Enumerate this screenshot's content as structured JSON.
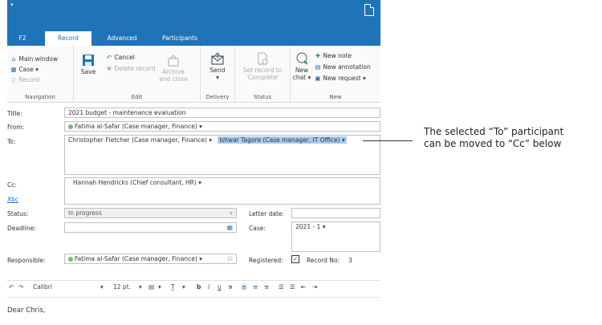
{
  "window": {
    "quick_access": "▾"
  },
  "tabs": [
    "F2",
    "Record",
    "Advanced",
    "Participants"
  ],
  "ribbon": {
    "navigation": {
      "items": [
        "Main window",
        "Case",
        "Record"
      ],
      "label": "Navigation"
    },
    "edit": {
      "save": "Save",
      "cancel": "Cancel",
      "delete": "Delete record",
      "archive": "Archive and close",
      "label": "Edit"
    },
    "delivery": {
      "send": "Send",
      "label": "Delivery"
    },
    "status": {
      "set_complete": "Set record to 'Complete'",
      "label": "Status"
    },
    "new": {
      "new_chat": "New chat",
      "new_note": "New note",
      "new_annotation": "New annotation",
      "new_request": "New request",
      "label": "New"
    }
  },
  "form": {
    "title_label": "Title:",
    "title_value": "2021 budget - maintenance evaluation",
    "from_label": "From:",
    "from_value": "Fatima al-Safar (Case manager, Finance)",
    "to_label": "To:",
    "to_1": "Christopher Fletcher (Case manager, Finance)",
    "to_2": "Ishwar Tagore (Case manager, IT Office)",
    "cc_label": "Cc:",
    "cc_value": "Hannah Hendricks (Chief consultant, HR)",
    "xbc_label": "Xbc",
    "status_label": "Status:",
    "status_value": "In progress",
    "deadline_label": "Deadline:",
    "letter_date_label": "Letter date:",
    "case_label": "Case:",
    "case_value": "2021 - 1",
    "responsible_label": "Responsible:",
    "responsible_value": "Fatima al-Safar (Case manager, Finance)",
    "registered_label": "Registered:",
    "record_no_label": "Record No:",
    "record_no_value": "3"
  },
  "editor": {
    "font": "Calibri",
    "size": "12 pt.",
    "body_text": "Dear Chris,"
  },
  "callout": {
    "line1": "The selected “To” participant",
    "line2": "can be moved to “Cc” below"
  },
  "colors": {
    "accent": "#1f73b7",
    "selection": "#a9cdf0"
  }
}
